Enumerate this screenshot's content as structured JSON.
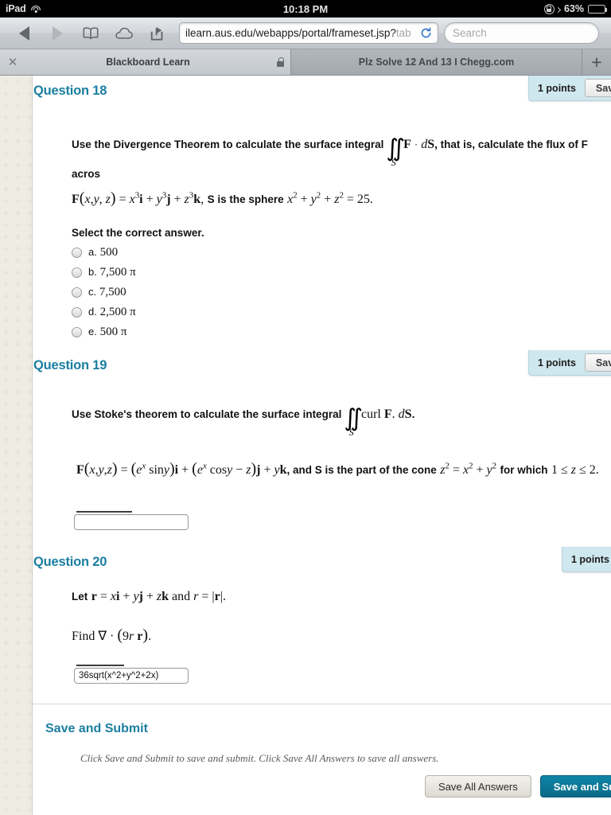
{
  "status_bar": {
    "device": "iPad",
    "wifi_icon": "wifi-icon",
    "time": "10:18 PM",
    "rotation_lock_icon": "rotation-lock-icon",
    "battery_percent": "63%",
    "battery_icon": "battery-icon"
  },
  "toolbar": {
    "back_icon": "back-arrow-icon",
    "forward_icon": "forward-arrow-icon",
    "bookmarks_icon": "bookmarks-book-icon",
    "icloud_icon": "icloud-tabs-icon",
    "share_icon": "share-icon",
    "url_visible": "ilearn.aus.edu/webapps/portal/frameset.jsp?",
    "url_faded": "tab",
    "reload_icon": "reload-icon",
    "search_placeholder": "Search"
  },
  "tabs": [
    {
      "title": "Blackboard Learn",
      "active": true,
      "close_icon": "close-icon",
      "lock_icon": "lock-icon"
    },
    {
      "title": "Plz Solve 12 And 13  I Chegg.com",
      "active": false
    }
  ],
  "new_tab_label": "+",
  "questions": [
    {
      "heading": "Question 18",
      "points": "1 points",
      "save_label": "Save",
      "prompt_pre": "Use the Divergence Theorem to calculate the surface integral",
      "integral_symbol": "∬",
      "integral_sub": "S",
      "integral_body": "F · dS",
      "prompt_post": ", that is, calculate the flux of F acros",
      "formula": "F(x,y,z) = x³i + y³j + z³k,",
      "formula_mid": "S is the sphere",
      "formula_end": "x² + y² + z² = 25.",
      "answer_label": "Select the correct answer.",
      "options": [
        {
          "letter": "a.",
          "text": "500"
        },
        {
          "letter": "b.",
          "text": "7,500 π"
        },
        {
          "letter": "c.",
          "text": "7,500"
        },
        {
          "letter": "d.",
          "text": "2,500 π"
        },
        {
          "letter": "e.",
          "text": "500 π"
        }
      ]
    },
    {
      "heading": "Question 19",
      "points": "1 points",
      "save_label": "Save",
      "prompt_pre": "Use Stoke's theorem to calculate the surface integral",
      "integral_symbol": "∬",
      "integral_sub": "S",
      "integral_body": "curl F. dS",
      "prompt_post": ".",
      "formula_a": "F(x,y,z) = (eˣ sin y)i + (eˣ cos y − z)j + yk",
      "formula_mid": ", and S is the part of the cone",
      "formula_cone": "z² = x² + y²",
      "formula_tail": "for which",
      "formula_range": "1 ≤ z ≤ 2.",
      "answer_value": ""
    },
    {
      "heading": "Question 20",
      "points": "1 points",
      "line1_pre": "Let",
      "line1": "r = xi + yj + zk and r = |r|.",
      "line2": "Find ∇ · (9 r r).",
      "answer_value": "36sqrt(x^2+y^2+2x)"
    }
  ],
  "submit_section": {
    "heading": "Save and Submit",
    "hint": "Click Save and Submit to save and submit. Click Save All Answers to save all answers.",
    "save_all_label": "Save All Answers",
    "save_submit_label": "Save and Sub"
  }
}
